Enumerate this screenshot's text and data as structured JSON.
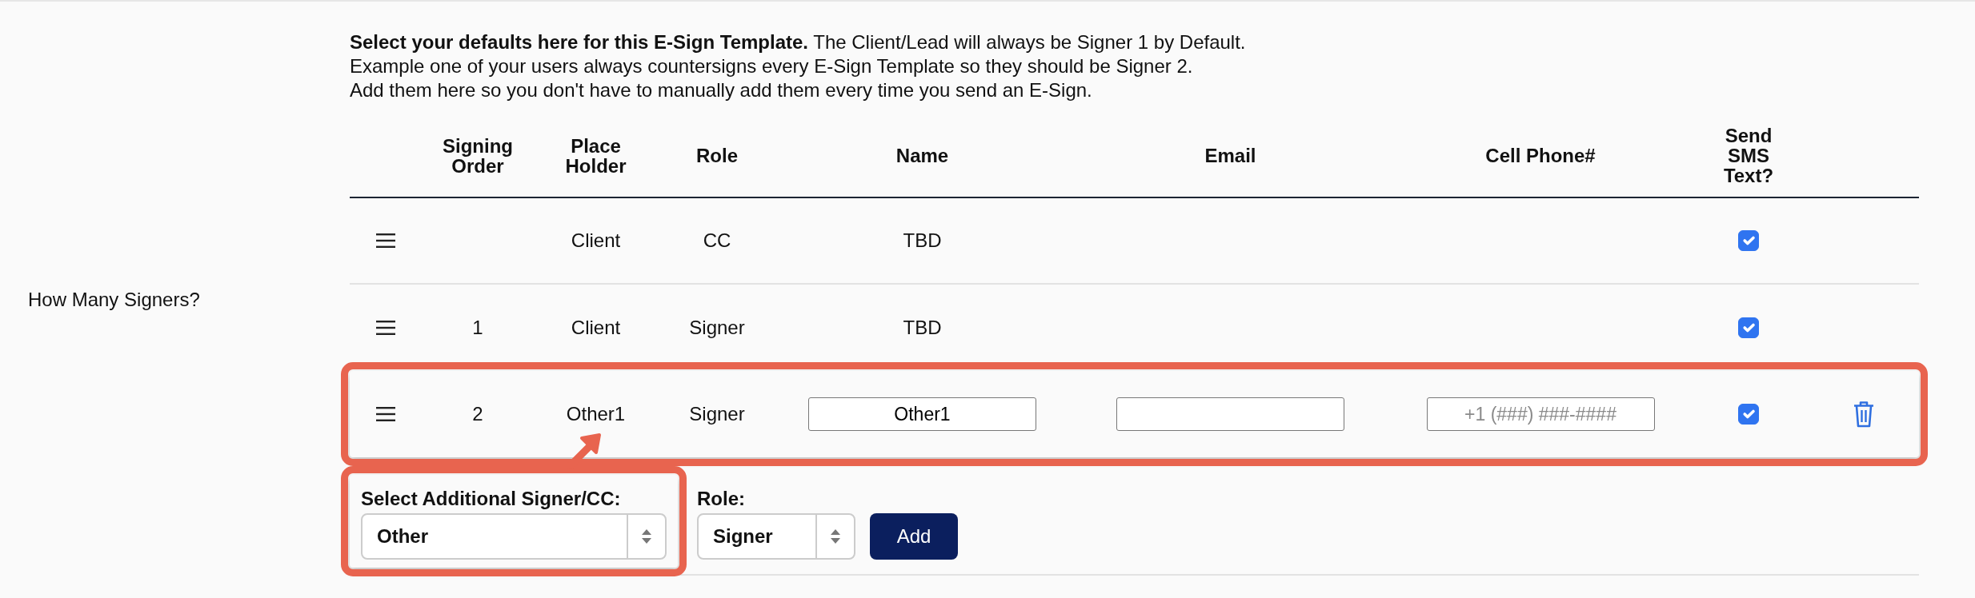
{
  "side_label": "How Many Signers?",
  "intro": [
    "**Select your defaults here for this E-Sign Template.** The Client/Lead will always be Signer 1 by Default.",
    "Example one of your users always countersigns every E-Sign Template so they should be Signer 2.",
    "Add them here so you don't have to manually add them every time you send an E-Sign."
  ],
  "table": {
    "columns": [
      "",
      "Signing Order",
      "Place Holder",
      "Role",
      "Name",
      "Email",
      "Cell Phone#",
      "Send SMS Text?",
      ""
    ],
    "rows": [
      {
        "kind": "fixed",
        "place_holder": "Client",
        "role": "CC",
        "name": "TBD",
        "sms_checked": true,
        "highlighted": false
      },
      {
        "kind": "fixed",
        "signing_order": "1",
        "place_holder": "Client",
        "role": "Signer",
        "name": "TBD",
        "sms_checked": true,
        "highlighted": false
      },
      {
        "kind": "editable",
        "signing_order": "2",
        "place_holder": "Other1",
        "role": "Signer",
        "name": "Other1",
        "phone_placeholder": "+1 (###) ###-####",
        "sms_checked": true,
        "deletable": true,
        "highlighted": true
      }
    ]
  },
  "add_form": {
    "signer_label": "Select Additional Signer/CC:",
    "signer_value": "Other",
    "signer_highlighted": true,
    "role_label": "Role:",
    "role_value": "Signer",
    "button": "Add"
  }
}
